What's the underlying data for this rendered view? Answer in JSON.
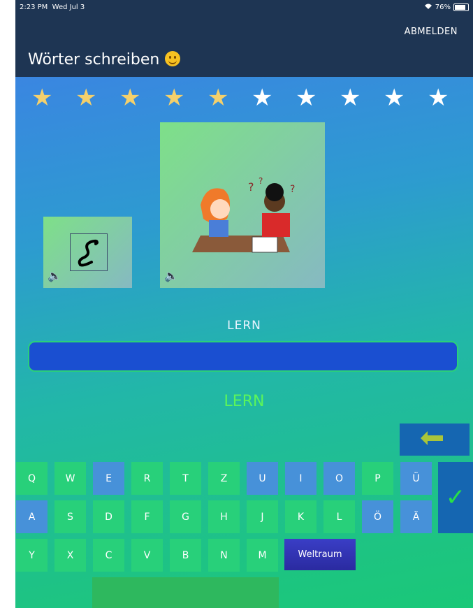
{
  "status": {
    "time": "2:23 PM",
    "date": "Wed Jul 3",
    "battery": "76%",
    "battery_level": 0.76
  },
  "header": {
    "logout_label": "ABMELDEN",
    "title": "Wörter schreiben"
  },
  "progress": {
    "filled_stars": 5,
    "total_stars": 10
  },
  "cards": {
    "small_speaker": "speaker-icon",
    "large_speaker": "speaker-icon"
  },
  "word": {
    "prompt": "LERN",
    "answer": "LERN",
    "input_value": ""
  },
  "keyboard": {
    "row1": [
      "Q",
      "W",
      "E",
      "R",
      "T",
      "Z",
      "U",
      "I",
      "O",
      "P",
      "Ü"
    ],
    "row2": [
      "A",
      "S",
      "D",
      "F",
      "G",
      "H",
      "J",
      "K",
      "L",
      "Ö",
      "Ä"
    ],
    "row3": [
      "Y",
      "X",
      "C",
      "V",
      "B",
      "N",
      "M"
    ],
    "space_label": "Weltraum",
    "check_label": "✓"
  },
  "colors": {
    "header": "#1e3553",
    "star_filled": "#f4d06c",
    "input": "#1a4fd1",
    "answer": "#5cf55a"
  }
}
